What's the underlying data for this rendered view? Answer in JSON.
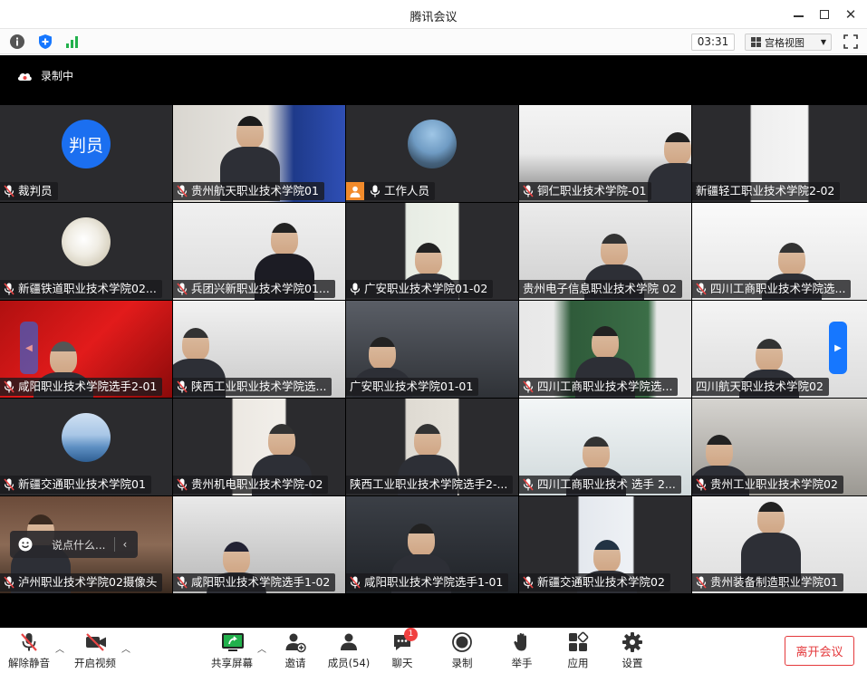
{
  "window": {
    "title": "腾讯会议"
  },
  "infobar": {
    "timer": "03:31",
    "view_label": "宫格视图"
  },
  "stage": {
    "recording_label": "录制中"
  },
  "participants": [
    {
      "name": "裁判员",
      "muted": true,
      "avatar_text": "判员"
    },
    {
      "name": "贵州航天职业技术学院01",
      "muted": true
    },
    {
      "name": "工作人员",
      "muted": false,
      "host": true
    },
    {
      "name": "铜仁职业技术学院-01",
      "muted": true
    },
    {
      "name": "新疆轻工职业技术学院2-02",
      "muted": false
    },
    {
      "name": "新疆铁道职业技术学院02...",
      "muted": true
    },
    {
      "name": "兵团兴新职业技术学院01...",
      "muted": true
    },
    {
      "name": "广安职业技术学院01-02",
      "muted": false
    },
    {
      "name": "贵州电子信息职业技术学院 02",
      "muted": false
    },
    {
      "name": "四川工商职业技术学院选...",
      "muted": true
    },
    {
      "name": "咸阳职业技术学院选手2-01",
      "muted": true
    },
    {
      "name": "陕西工业职业技术学院选...",
      "muted": true
    },
    {
      "name": "广安职业技术学院01-01",
      "muted": false
    },
    {
      "name": "四川工商职业技术学院选...",
      "muted": true
    },
    {
      "name": "四川航天职业技术学院02",
      "muted": false
    },
    {
      "name": "新疆交通职业技术学院01",
      "muted": true
    },
    {
      "name": "贵州机电职业技术学院-02",
      "muted": true
    },
    {
      "name": "陕西工业职业技术学院选手2-...",
      "muted": false
    },
    {
      "name": "四川工商职业技术 选手 2...",
      "muted": true
    },
    {
      "name": "贵州工业职业技术学院02",
      "muted": true
    },
    {
      "name": "泸州职业技术学院02摄像头",
      "muted": true
    },
    {
      "name": "咸阳职业技术学院选手1-02",
      "muted": true
    },
    {
      "name": "咸阳职业技术学院选手1-01",
      "muted": true
    },
    {
      "name": "新疆交通职业技术学院02",
      "muted": true
    },
    {
      "name": "贵州装备制造职业学院01",
      "muted": true
    }
  ],
  "chat": {
    "placeholder": "说点什么..."
  },
  "toolbar": {
    "unmute": "解除静音",
    "start_video": "开启视频",
    "share_screen": "共享屏幕",
    "invite": "邀请",
    "members": "成员(54)",
    "chat": "聊天",
    "chat_badge": "1",
    "record": "录制",
    "raise_hand": "举手",
    "apps": "应用",
    "settings": "设置",
    "leave": "离开会议"
  },
  "colors": {
    "accent": "#1677ff",
    "leave": "#e4393c",
    "host_badge": "#f28b2b",
    "muted_mic": "#e84545"
  }
}
